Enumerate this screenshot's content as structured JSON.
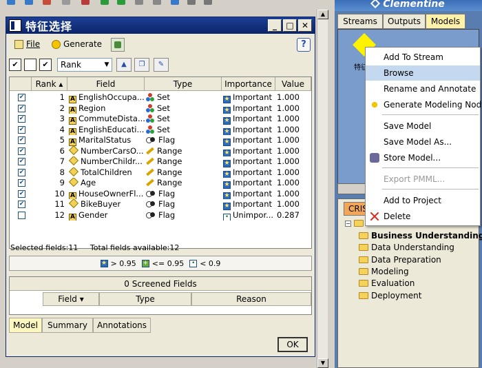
{
  "dialog": {
    "title": "特征选择",
    "menu": {
      "file": "File",
      "generate": "Generate"
    },
    "sort_by": "Rank",
    "columns": [
      "Rank",
      "Field",
      "Type",
      "Importance",
      "Value"
    ],
    "rows": [
      {
        "rank": "1",
        "field": "EnglishOccupa...",
        "type": "Set",
        "importance": "Important",
        "value": "1.000",
        "checked": true,
        "field_icon": "A"
      },
      {
        "rank": "2",
        "field": "Region",
        "type": "Set",
        "importance": "Important",
        "value": "1.000",
        "checked": true,
        "field_icon": "A"
      },
      {
        "rank": "3",
        "field": "CommuteDista...",
        "type": "Set",
        "importance": "Important",
        "value": "1.000",
        "checked": true,
        "field_icon": "A"
      },
      {
        "rank": "4",
        "field": "EnglishEducati...",
        "type": "Set",
        "importance": "Important",
        "value": "1.000",
        "checked": true,
        "field_icon": "A"
      },
      {
        "rank": "5",
        "field": "MaritalStatus",
        "type": "Flag",
        "importance": "Important",
        "value": "1.000",
        "checked": true,
        "field_icon": "A"
      },
      {
        "rank": "6",
        "field": "NumberCarsO...",
        "type": "Range",
        "importance": "Important",
        "value": "1.000",
        "checked": true,
        "field_icon": "D"
      },
      {
        "rank": "7",
        "field": "NumberChildr...",
        "type": "Range",
        "importance": "Important",
        "value": "1.000",
        "checked": true,
        "field_icon": "D"
      },
      {
        "rank": "8",
        "field": "TotalChildren",
        "type": "Range",
        "importance": "Important",
        "value": "1.000",
        "checked": true,
        "field_icon": "D"
      },
      {
        "rank": "9",
        "field": "Age",
        "type": "Range",
        "importance": "Important",
        "value": "1.000",
        "checked": true,
        "field_icon": "D"
      },
      {
        "rank": "10",
        "field": "HouseOwnerFl...",
        "type": "Flag",
        "importance": "Important",
        "value": "1.000",
        "checked": true,
        "field_icon": "A"
      },
      {
        "rank": "11",
        "field": "BikeBuyer",
        "type": "Flag",
        "importance": "Important",
        "value": "1.000",
        "checked": true,
        "field_icon": "D"
      },
      {
        "rank": "12",
        "field": "Gender",
        "type": "Flag",
        "importance": "Unimpor...",
        "value": "0.287",
        "checked": false,
        "field_icon": "A"
      }
    ],
    "status": {
      "selected": "Selected fields:11",
      "total": "Total fields available:12"
    },
    "legend": {
      "high": "> 0.95",
      "mid": "<= 0.95",
      "low": "< 0.9"
    },
    "screened": {
      "title": "0 Screened Fields",
      "columns": [
        "Field",
        "Type",
        "Reason"
      ]
    },
    "tabs": [
      "Model",
      "Summary",
      "Annotations"
    ],
    "ok_label": "OK"
  },
  "right_panel": {
    "brand": "Clementine",
    "tabs": [
      "Streams",
      "Outputs",
      "Models"
    ],
    "model_label": "特征选"
  },
  "context_menu": {
    "items": [
      "Add To Stream",
      "Browse",
      "Rename and Annotate",
      "Generate Modeling Node",
      "Save Model",
      "Save Model As...",
      "Store Model...",
      "Export PMML...",
      "Add to Project",
      "Delete"
    ]
  },
  "project": {
    "tab": "CRISI",
    "items": [
      "Business Understanding",
      "Data Understanding",
      "Data Preparation",
      "Modeling",
      "Evaluation",
      "Deployment"
    ]
  },
  "colors": {
    "title_bar": "#0a246a",
    "hover": "#c4d8ef",
    "models_bg": "#7a9ccc",
    "delete": "#d8281a"
  }
}
